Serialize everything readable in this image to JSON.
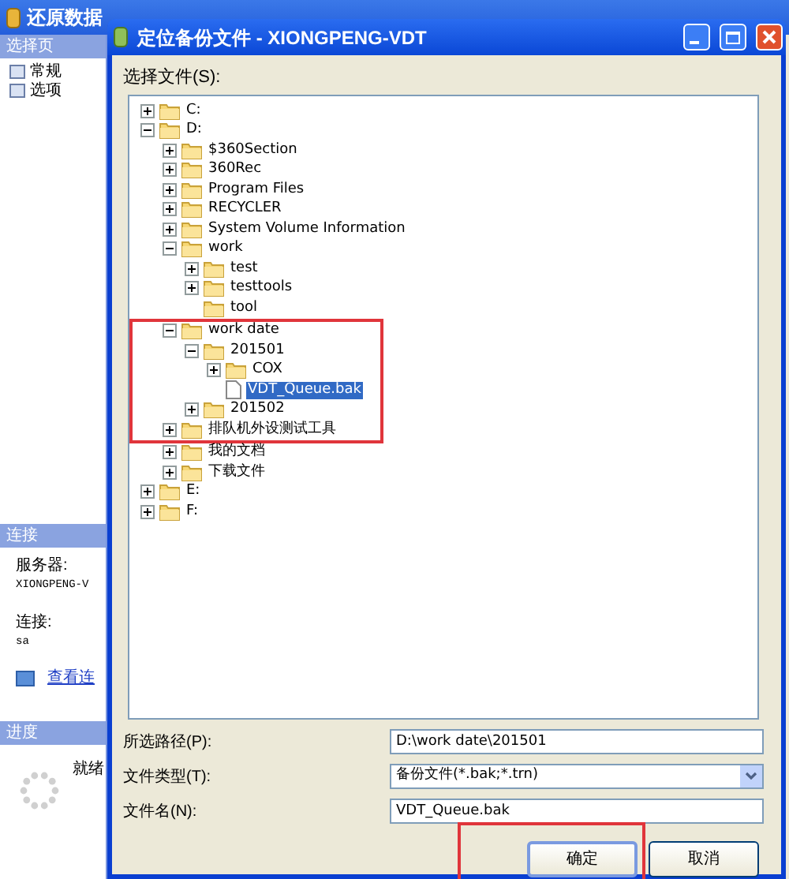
{
  "background_window": {
    "title": "还原数据",
    "select_page": {
      "header": "选择页",
      "items": [
        {
          "label": "常规",
          "selected": false
        },
        {
          "label": "选项",
          "selected": false
        }
      ]
    },
    "connection": {
      "header": "连接",
      "server_label": "服务器:",
      "server": "XIONGPENG-V",
      "login_label": "连接:",
      "login": "sa",
      "link": "查看连"
    },
    "progress": {
      "header": "进度",
      "status": "就绪"
    }
  },
  "dialog": {
    "title": "定位备份文件 - XIONGPENG-VDT",
    "tree_label": "选择文件(S):",
    "tree": [
      {
        "kind": "drive",
        "label": "C:",
        "expanded": false
      },
      {
        "kind": "drive",
        "label": "D:",
        "expanded": true,
        "children": [
          {
            "kind": "folder",
            "label": "$360Section",
            "expanded": false
          },
          {
            "kind": "folder",
            "label": "360Rec",
            "expanded": false
          },
          {
            "kind": "folder",
            "label": "Program Files",
            "expanded": false
          },
          {
            "kind": "folder",
            "label": "RECYCLER",
            "expanded": false
          },
          {
            "kind": "folder",
            "label": "System Volume Information",
            "expanded": false
          },
          {
            "kind": "folder",
            "label": "work",
            "expanded": true,
            "children": [
              {
                "kind": "folder",
                "label": "test",
                "expanded": false
              },
              {
                "kind": "folder",
                "label": "testtools",
                "expanded": false
              },
              {
                "kind": "empty_folder",
                "label": "tool"
              }
            ]
          },
          {
            "kind": "folder",
            "label": "work date",
            "expanded": true,
            "framed": true,
            "children": [
              {
                "kind": "folder",
                "label": "201501",
                "expanded": true,
                "children": [
                  {
                    "kind": "folder",
                    "label": "COX",
                    "expanded": false
                  },
                  {
                    "kind": "file",
                    "label": "VDT_Queue.bak",
                    "selected": true
                  }
                ]
              },
              {
                "kind": "folder",
                "label": "201502",
                "expanded": false
              }
            ]
          },
          {
            "kind": "folder",
            "label": "排队机外设测试工具",
            "expanded": false,
            "framed": true
          },
          {
            "kind": "folder",
            "label": "我的文档",
            "expanded": false
          },
          {
            "kind": "folder",
            "label": "下载文件",
            "expanded": false
          }
        ]
      },
      {
        "kind": "drive",
        "label": "E:",
        "expanded": false
      },
      {
        "kind": "drive",
        "label": "F:",
        "expanded": false
      }
    ],
    "fields": [
      {
        "kind": "text",
        "label": "所选路径(P):",
        "value": "D:\\work date\\201501"
      },
      {
        "kind": "dropdown",
        "label": "文件类型(T):",
        "value": "备份文件(*.bak;*.trn)"
      },
      {
        "kind": "text",
        "label": "文件名(N):",
        "value": "VDT_Queue.bak"
      }
    ],
    "buttons": [
      {
        "label": "确定",
        "default": true,
        "framed": true
      },
      {
        "label": "取消",
        "default": false,
        "framed": false
      }
    ]
  }
}
